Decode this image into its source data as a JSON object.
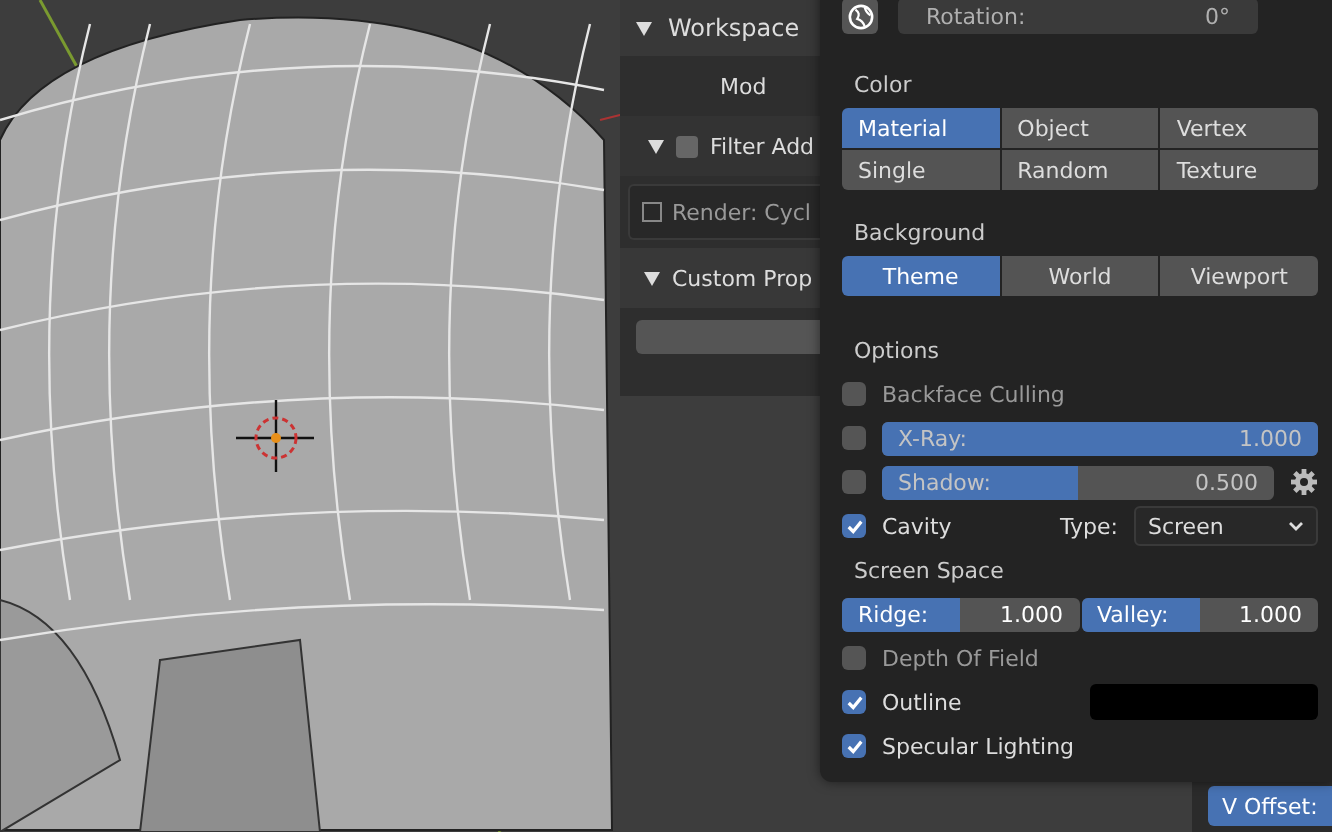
{
  "workspace_panel": {
    "title": "Workspace",
    "mode_label": "Mod",
    "filter": {
      "label": "Filter Add",
      "checked": false
    },
    "addon": {
      "label": "Render: Cycl",
      "checked": false
    },
    "custom_title": "Custom Prop"
  },
  "properties_panel": {
    "button": "V Offset:"
  },
  "shading": {
    "rotation": {
      "label": "Rotation:",
      "value": "0°"
    },
    "color": {
      "heading": "Color",
      "options": [
        {
          "label": "Material",
          "selected": true
        },
        {
          "label": "Object",
          "selected": false
        },
        {
          "label": "Vertex",
          "selected": false
        },
        {
          "label": "Single",
          "selected": false
        },
        {
          "label": "Random",
          "selected": false
        },
        {
          "label": "Texture",
          "selected": false
        }
      ]
    },
    "background": {
      "heading": "Background",
      "options": [
        {
          "label": "Theme",
          "selected": true
        },
        {
          "label": "World",
          "selected": false
        },
        {
          "label": "Viewport",
          "selected": false
        }
      ]
    },
    "options": {
      "heading": "Options",
      "items": [
        {
          "kind": "check",
          "label": "Backface Culling",
          "checked": false
        },
        {
          "kind": "slider",
          "label": "X-Ray:",
          "value": "1.000",
          "level": 1,
          "checked": false
        },
        {
          "kind": "slider",
          "label": "Shadow:",
          "value": "0.500",
          "level": 0.5,
          "checked": false,
          "gear": true
        },
        {
          "kind": "cavity",
          "label": "Cavity",
          "checked": true,
          "type_label": "Type:",
          "type_value": "Screen"
        },
        {
          "kind": "heading",
          "label": "Screen Space"
        },
        {
          "kind": "pair",
          "sliders": [
            {
              "label": "Ridge:",
              "value": "1.000",
              "level": 0.5
            },
            {
              "label": "Valley:",
              "value": "1.000",
              "level": 0.5
            }
          ]
        },
        {
          "kind": "check",
          "label": "Depth Of Field",
          "checked": false
        },
        {
          "kind": "color",
          "label": "Outline",
          "checked": true,
          "color": "#000000"
        },
        {
          "kind": "check",
          "label": "Specular Lighting",
          "checked": true
        }
      ]
    }
  }
}
